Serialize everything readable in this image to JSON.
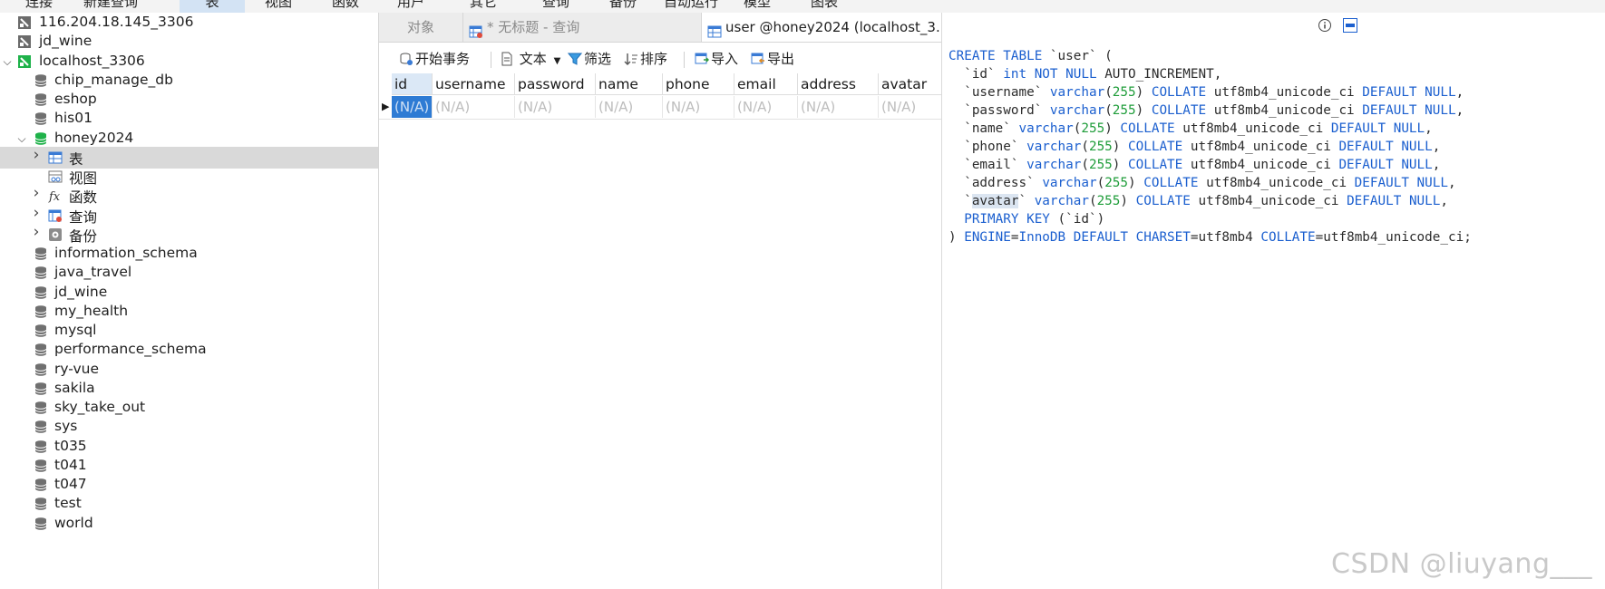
{
  "menubar": {
    "items": [
      "连接",
      "新建查询",
      "表",
      "视图",
      "函数",
      "用户",
      "其它",
      "查询",
      "备份",
      "自动运行",
      "模型",
      "图表"
    ]
  },
  "tree": {
    "items": [
      {
        "label": "116.204.18.145_3306",
        "type": "connection-off"
      },
      {
        "label": "jd_wine",
        "type": "connection-off"
      },
      {
        "label": "localhost_3306",
        "type": "connection-on"
      },
      {
        "label": "chip_manage_db",
        "type": "database"
      },
      {
        "label": "eshop",
        "type": "database"
      },
      {
        "label": "his01",
        "type": "database"
      },
      {
        "label": "honey2024",
        "type": "database-open"
      },
      {
        "label": "表",
        "type": "tables"
      },
      {
        "label": "视图",
        "type": "views"
      },
      {
        "label": "函数",
        "type": "functions"
      },
      {
        "label": "查询",
        "type": "queries"
      },
      {
        "label": "备份",
        "type": "backups"
      },
      {
        "label": "information_schema",
        "type": "database"
      },
      {
        "label": "java_travel",
        "type": "database"
      },
      {
        "label": "jd_wine",
        "type": "database"
      },
      {
        "label": "my_health",
        "type": "database"
      },
      {
        "label": "mysql",
        "type": "database"
      },
      {
        "label": "performance_schema",
        "type": "database"
      },
      {
        "label": "ry-vue",
        "type": "database"
      },
      {
        "label": "sakila",
        "type": "database"
      },
      {
        "label": "sky_take_out",
        "type": "database"
      },
      {
        "label": "sys",
        "type": "database"
      },
      {
        "label": "t035",
        "type": "database"
      },
      {
        "label": "t041",
        "type": "database"
      },
      {
        "label": "t047",
        "type": "database"
      },
      {
        "label": "test",
        "type": "database"
      },
      {
        "label": "world",
        "type": "database"
      }
    ]
  },
  "tabs": [
    {
      "label": "对象"
    },
    {
      "label": "* 无标题 - 查询"
    },
    {
      "label": "user @honey2024 (localhost_3..."
    }
  ],
  "toolbar": {
    "begin_transaction": "开始事务",
    "text": "文本",
    "filter": "筛选",
    "sort": "排序",
    "import": "导入",
    "export": "导出"
  },
  "grid": {
    "columns": [
      "id",
      "username",
      "password",
      "name",
      "phone",
      "email",
      "address",
      "avatar"
    ],
    "row": [
      "(N/A)",
      "(N/A)",
      "(N/A)",
      "(N/A)",
      "(N/A)",
      "(N/A)",
      "(N/A)",
      "(N/A)"
    ]
  },
  "ddl": {
    "lines": [
      "CREATE TABLE `user` (",
      "  `id` int NOT NULL AUTO_INCREMENT,",
      "  `username` varchar(255) COLLATE utf8mb4_unicode_ci DEFAULT NULL,",
      "  `password` varchar(255) COLLATE utf8mb4_unicode_ci DEFAULT NULL,",
      "  `name` varchar(255) COLLATE utf8mb4_unicode_ci DEFAULT NULL,",
      "  `phone` varchar(255) COLLATE utf8mb4_unicode_ci DEFAULT NULL,",
      "  `email` varchar(255) COLLATE utf8mb4_unicode_ci DEFAULT NULL,",
      "  `address` varchar(255) COLLATE utf8mb4_unicode_ci DEFAULT NULL,",
      "  `avatar` varchar(255) COLLATE utf8mb4_unicode_ci DEFAULT NULL,",
      "  PRIMARY KEY (`id`)",
      ") ENGINE=InnoDB DEFAULT CHARSET=utf8mb4 COLLATE=utf8mb4_unicode_ci;"
    ],
    "highlighted_word": "avatar"
  },
  "watermark": "CSDN @liuyang___",
  "colors": {
    "keyword": "#1b5fcf",
    "number": "#1f9d3a",
    "selected_cell": "#2e7bd4",
    "tree_selected": "#d9d9d9"
  }
}
